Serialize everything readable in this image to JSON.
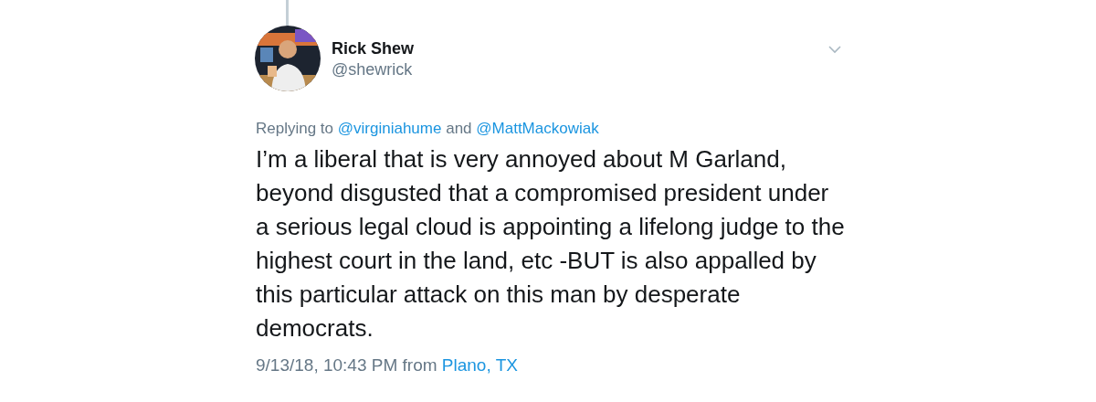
{
  "tweet": {
    "author": {
      "name": "Rick Shew",
      "handle": "@shewrick"
    },
    "replying_to": {
      "prefix": "Replying to",
      "mentions": [
        "@virginiahume",
        "@MattMackowiak"
      ],
      "joiner": "and"
    },
    "body_lines": [
      "I’m a liberal that is very annoyed about M Garland,",
      "beyond disgusted that a compromised president under",
      "a serious legal cloud is appointing a lifelong judge to the",
      "highest court in the land, etc -BUT is also appalled by",
      "this particular attack on this man by desperate",
      "democrats."
    ],
    "timestamp": "9/13/18, 10:43 PM",
    "source_prefix": "from",
    "location": "Plano, TX"
  }
}
